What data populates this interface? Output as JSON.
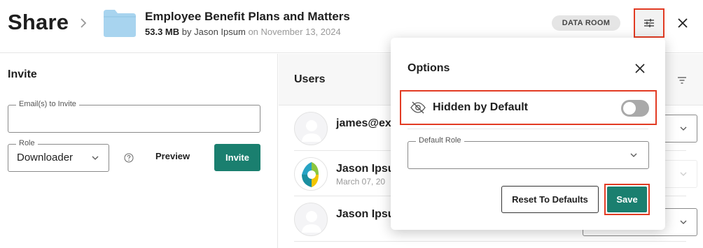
{
  "header": {
    "title": "Share",
    "file": {
      "name": "Employee Benefit Plans and Matters",
      "size": "53.3 MB",
      "by": "by Jason Ipsum",
      "date_text": "on November 13, 2024"
    },
    "badge": "DATA ROOM",
    "icons": {
      "crumb": "chevron-right-icon",
      "folder": "folder-icon",
      "options": "sliders-icon",
      "close": "close-icon"
    }
  },
  "invite": {
    "title": "Invite",
    "email_legend": "Email(s) to Invite",
    "email_value": "",
    "role_legend": "Role",
    "role_value": "Downloader",
    "preview_label": "Preview",
    "invite_label": "Invite"
  },
  "users": {
    "title": "Users",
    "rows": [
      {
        "name": "james@ex",
        "date": ""
      },
      {
        "name": "Jason Ipsu",
        "date": "March 07, 20"
      },
      {
        "name": "Jason Ipsu",
        "date": ""
      }
    ]
  },
  "options_modal": {
    "title": "Options",
    "hidden_label": "Hidden by Default",
    "hidden_enabled": false,
    "default_role_legend": "Default Role",
    "default_role_value": "",
    "reset_label": "Reset To Defaults",
    "save_label": "Save"
  },
  "colors": {
    "accent": "#1a7f6f",
    "highlight": "#e23b23",
    "folder": "#a8d4ef"
  }
}
